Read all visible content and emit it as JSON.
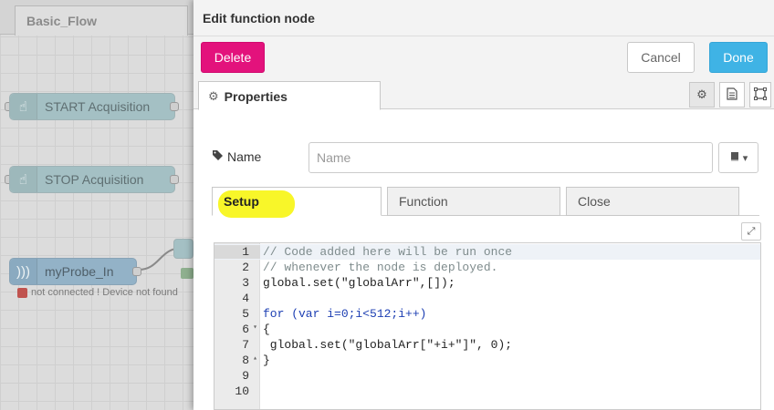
{
  "workspace": {
    "flow_tab": "Basic_Flow",
    "nodes": [
      {
        "label": "START Acquisition",
        "icon": "hand-icon"
      },
      {
        "label": "STOP Acquisition",
        "icon": "hand-icon"
      },
      {
        "label": "myProbe_In",
        "icon": "wave-icon"
      }
    ],
    "status_text": "not connected ! Device not found"
  },
  "editor": {
    "title": "Edit function node",
    "delete_label": "Delete",
    "cancel_label": "Cancel",
    "done_label": "Done",
    "properties_tab": "Properties",
    "name_label": "Name",
    "name_placeholder": "Name",
    "name_value": "",
    "sub_tabs": [
      "Setup",
      "Function",
      "Close"
    ],
    "code_lines": [
      "// Code added here will be run once",
      "// whenever the node is deployed.",
      "global.set(\"globalArr\",[]);",
      "",
      "for (var i=0;i<512;i++)",
      "{",
      " global.set(\"globalArr[\"+i+\"]\", 0);",
      "}",
      "",
      ""
    ],
    "line_numbers": [
      "1",
      "2",
      "3",
      "4",
      "5",
      "6",
      "7",
      "8",
      "9",
      "10"
    ]
  },
  "colors": {
    "delete": "#e3127c",
    "done": "#3fb3e5",
    "highlight": "#f8f51e"
  }
}
